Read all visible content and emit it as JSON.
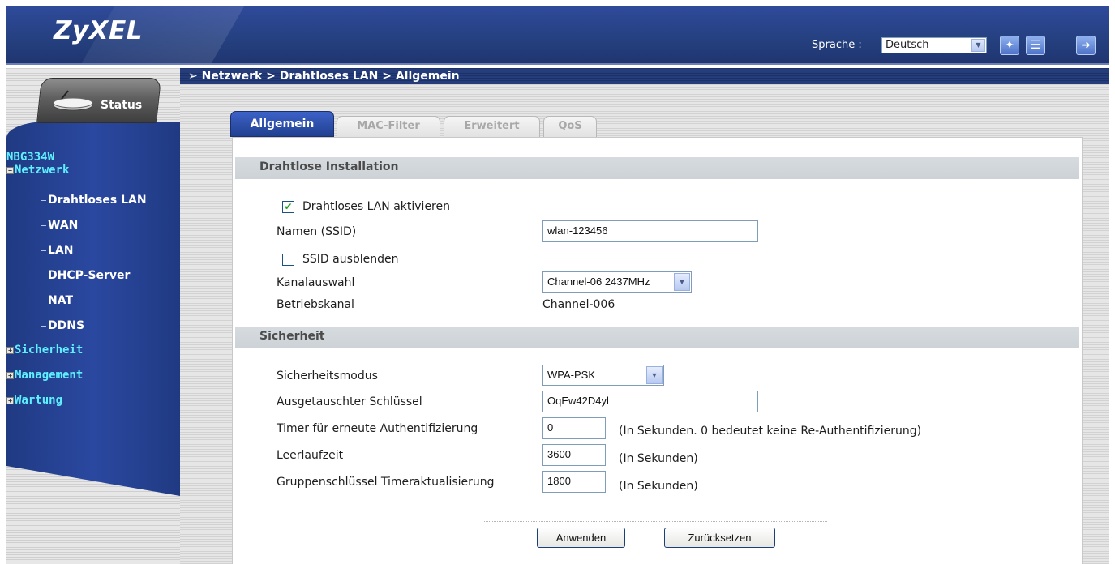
{
  "header": {
    "logo": "ZyXEL",
    "language_label": "Sprache :",
    "language_value": "Deutsch",
    "icons": [
      "wizard-icon",
      "help-icon",
      "logout-icon"
    ]
  },
  "breadcrumb": "Netzwerk > Drahtloses LAN > Allgemein",
  "sidebar": {
    "status_label": "Status",
    "device": "NBG334W",
    "groups": [
      {
        "label": "Netzwerk",
        "expanded": true
      },
      {
        "label": "Sicherheit",
        "expanded": false
      },
      {
        "label": "Management",
        "expanded": false
      },
      {
        "label": "Wartung",
        "expanded": false
      }
    ],
    "items": [
      "Drahtloses LAN",
      "WAN",
      "LAN",
      "DHCP-Server",
      "NAT",
      "DDNS"
    ]
  },
  "tabs": [
    {
      "label": "Allgemein",
      "active": true
    },
    {
      "label": "MAC-Filter",
      "active": false
    },
    {
      "label": "Erweitert",
      "active": false
    },
    {
      "label": "QoS",
      "active": false
    }
  ],
  "wireless": {
    "section_title": "Drahtlose Installation",
    "enable_label": "Drahtloses LAN aktivieren",
    "enable_checked": true,
    "ssid_label": "Namen (SSID)",
    "ssid_value": "wlan-123456",
    "hide_ssid_label": "SSID ausblenden",
    "hide_ssid_checked": false,
    "channel_label": "Kanalauswahl",
    "channel_value": "Channel-06 2437MHz",
    "operating_channel_label": "Betriebskanal",
    "operating_channel_value": "Channel-006"
  },
  "security": {
    "section_title": "Sicherheit",
    "mode_label": "Sicherheitsmodus",
    "mode_value": "WPA-PSK",
    "key_label": "Ausgetauschter Schlüssel",
    "key_value": "OqEw42D4yl",
    "reauth_label": "Timer für erneute Authentifizierung",
    "reauth_value": "0",
    "reauth_hint": "(In Sekunden. 0 bedeutet keine Re-Authentifizierung)",
    "idle_label": "Leerlaufzeit",
    "idle_value": "3600",
    "idle_hint": "(In Sekunden)",
    "group_key_label": "Gruppenschlüssel Timeraktualisierung",
    "group_key_value": "1800",
    "group_key_hint": "(In Sekunden)"
  },
  "buttons": {
    "apply": "Anwenden",
    "reset": "Zurücksetzen"
  }
}
